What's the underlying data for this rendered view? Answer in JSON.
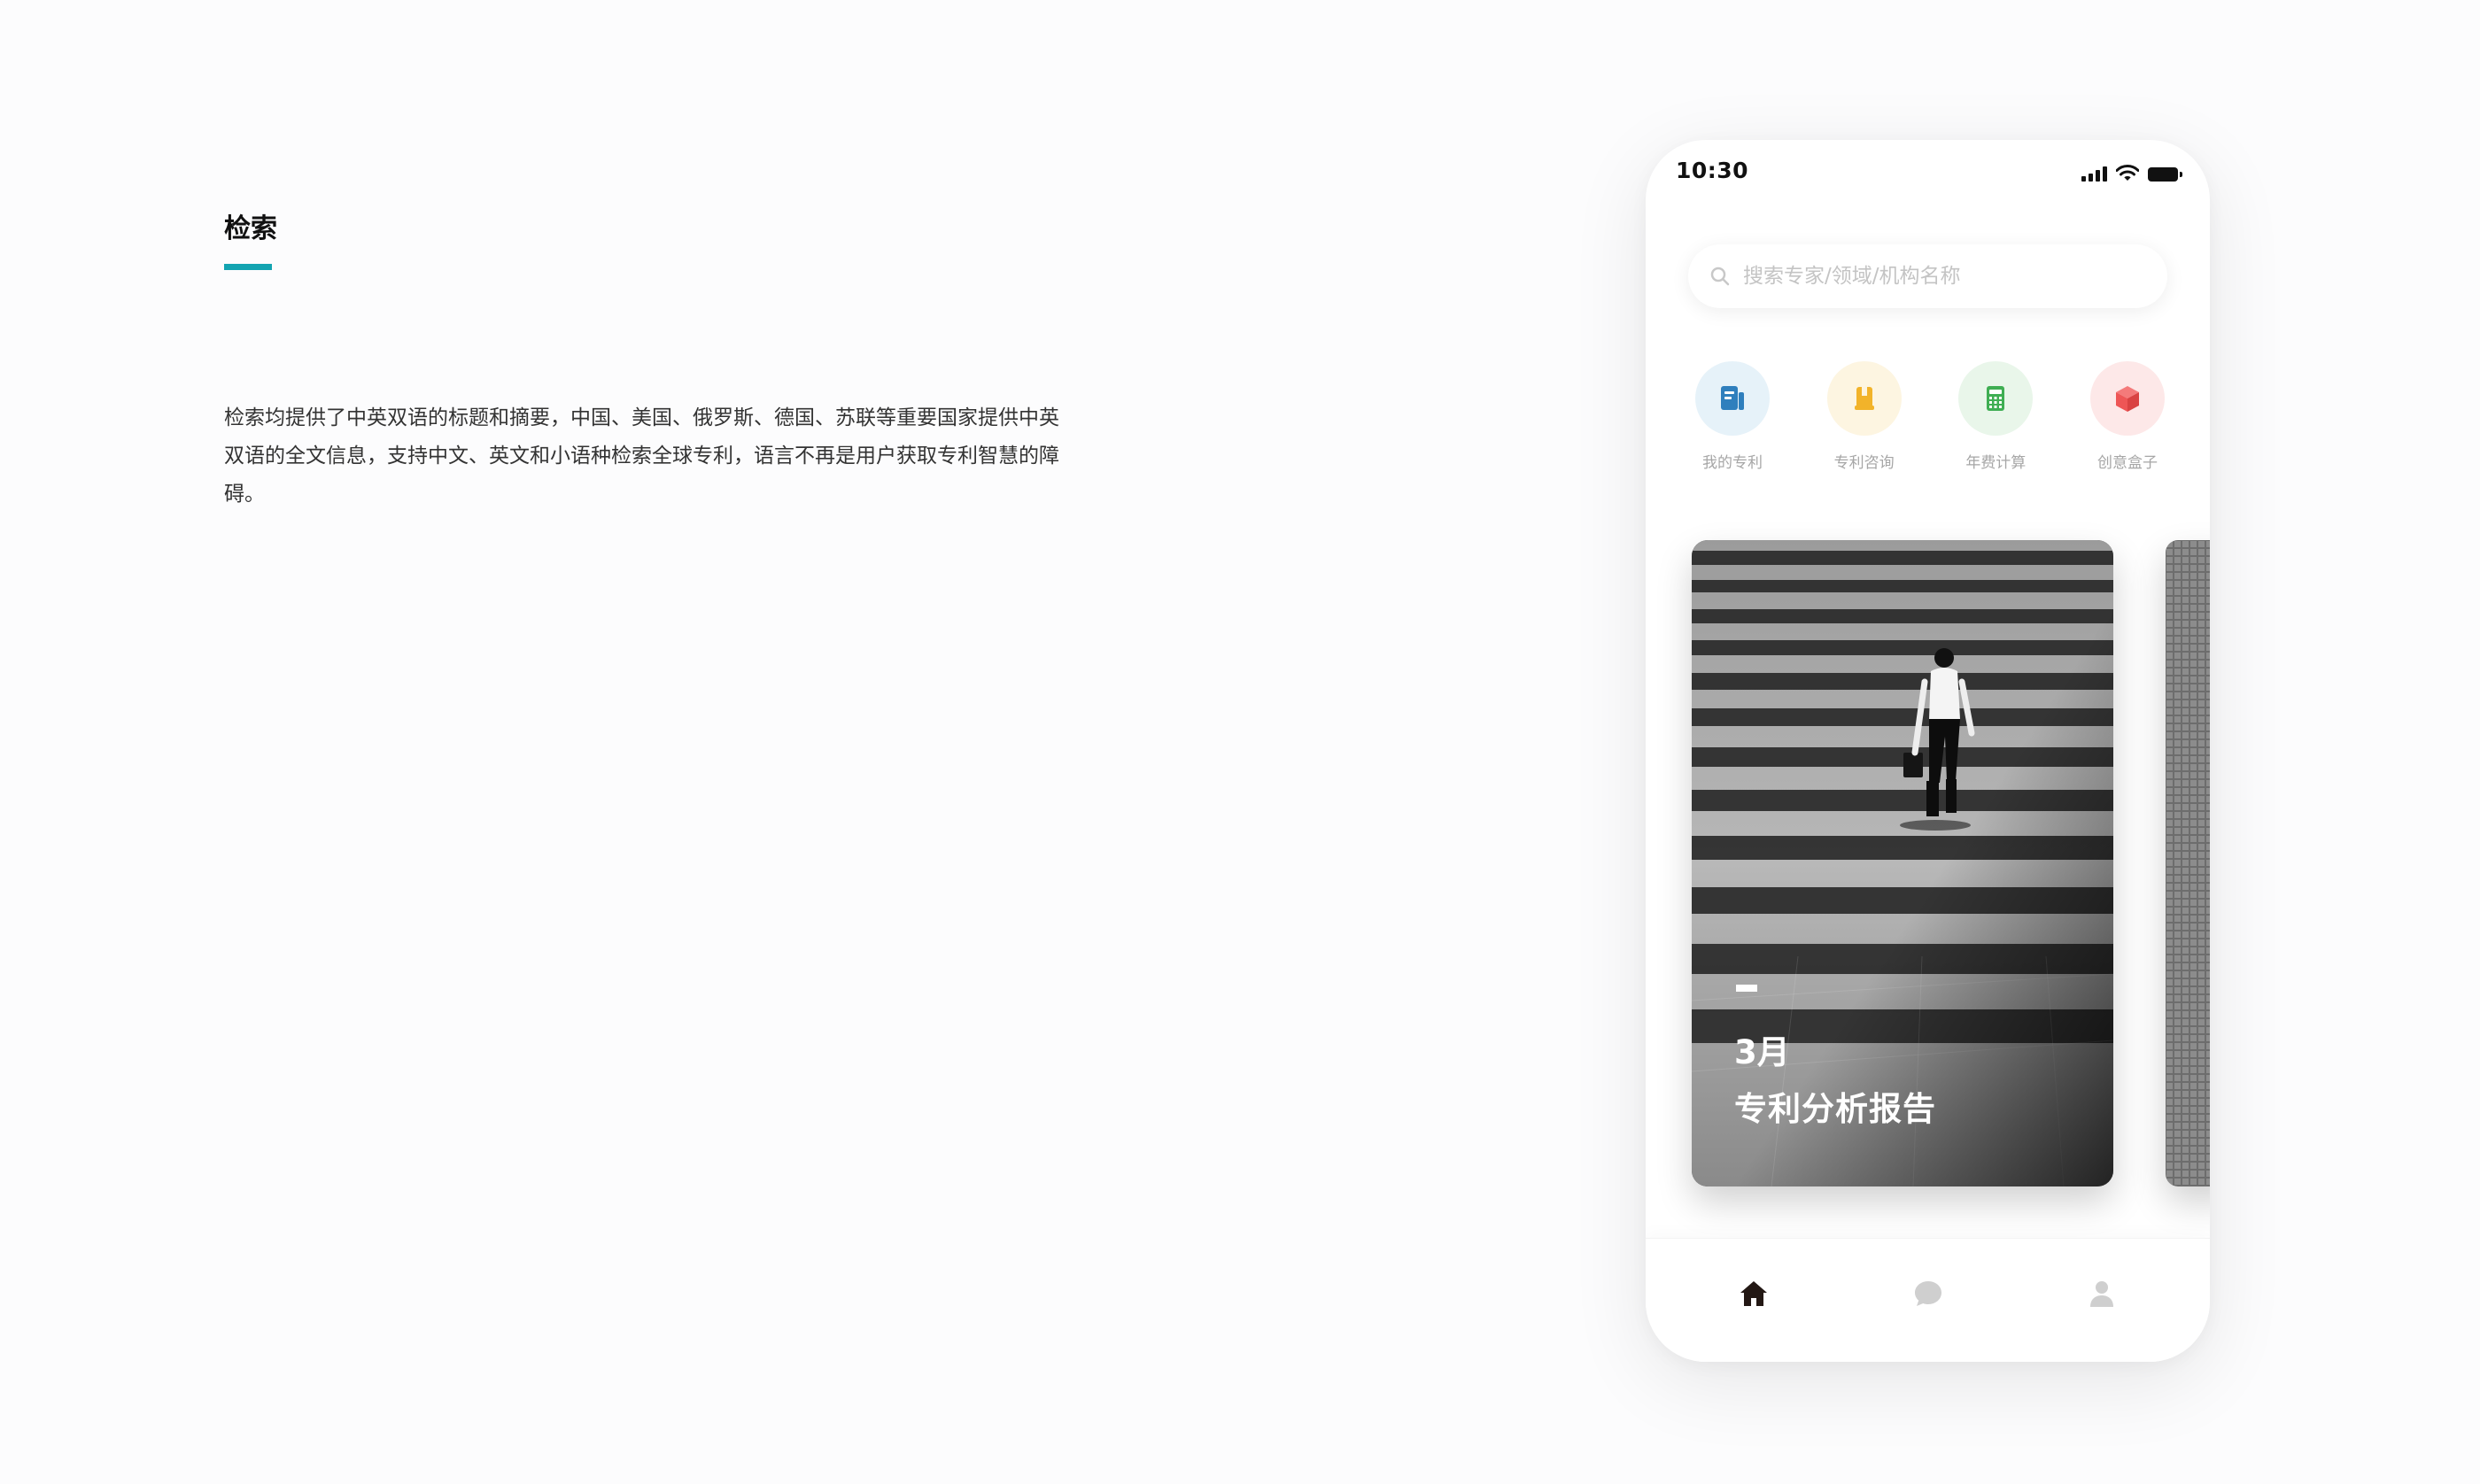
{
  "intro": {
    "title": "检索",
    "description": "检索均提供了中英双语的标题和摘要，中国、美国、俄罗斯、德国、苏联等重要国家提供中英双语的全文信息，支持中文、英文和小语种检索全球专利，语言不再是用户获取专利智慧的障碍。",
    "accent_color": "#13a4b1"
  },
  "phone": {
    "status_bar": {
      "time": "10:30"
    },
    "search": {
      "placeholder": "搜索专家/领域/机构名称",
      "icon": "search-icon"
    },
    "quick_actions": [
      {
        "label": "我的专利",
        "icon": "book-icon",
        "bg": "#e6f2f9",
        "color": "#2f7fbd"
      },
      {
        "label": "专利咨询",
        "icon": "bookmark-icon",
        "bg": "#fdf5e1",
        "color": "#f2b32a"
      },
      {
        "label": "年费计算",
        "icon": "calculator-icon",
        "bg": "#e9f6ea",
        "color": "#3fae53"
      },
      {
        "label": "创意盒子",
        "icon": "box-icon",
        "bg": "#fde8e8",
        "color": "#ee5656"
      }
    ],
    "cards": [
      {
        "month": "3月",
        "title": "专利分析报告"
      }
    ],
    "tabbar": [
      {
        "name": "home",
        "icon": "home-icon",
        "active": true
      },
      {
        "name": "messages",
        "icon": "chat-bubble-icon",
        "active": false
      },
      {
        "name": "profile",
        "icon": "user-icon",
        "active": false
      }
    ]
  }
}
